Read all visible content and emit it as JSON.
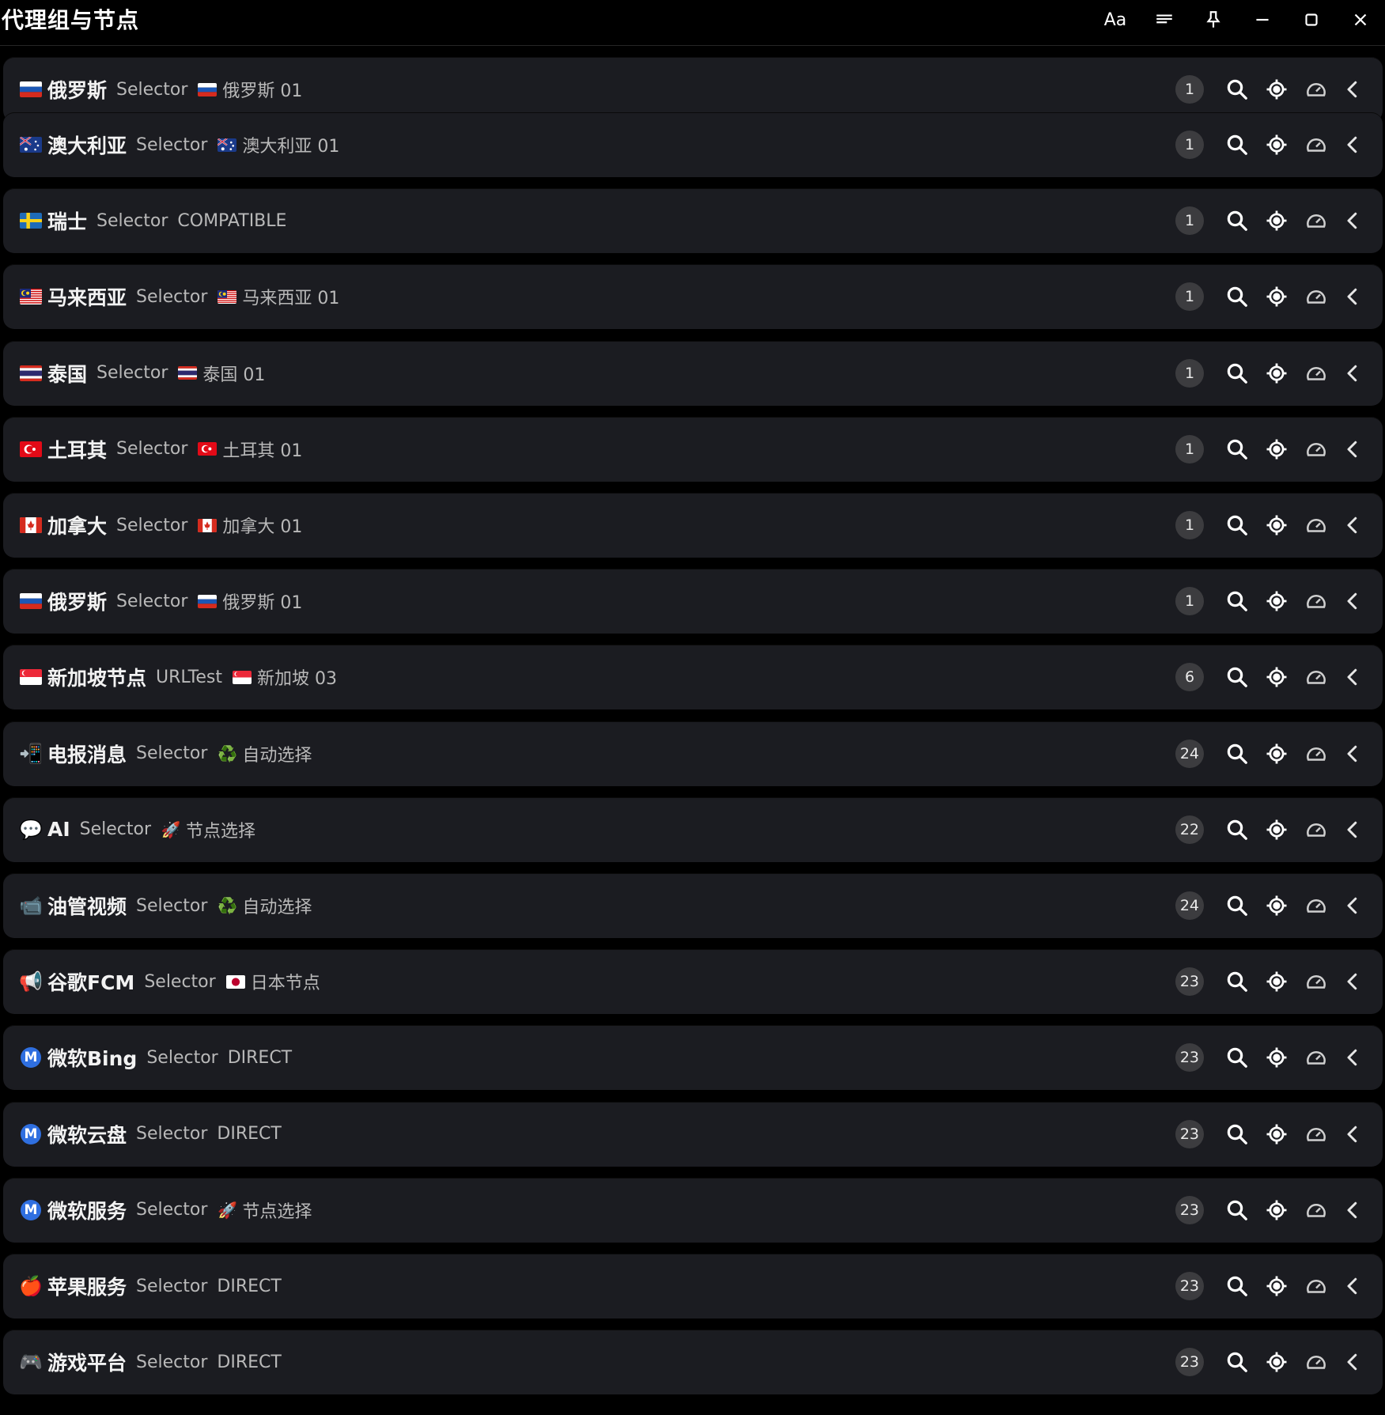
{
  "window": {
    "title": "代理组与节点",
    "font_button": "Aa",
    "icons": [
      "font-icon",
      "filter-lines-icon",
      "pin-icon",
      "minimize-icon",
      "maximize-icon",
      "close-icon"
    ]
  },
  "colors": {
    "background": "#000000",
    "card": "#1b1c21",
    "badge": "#3c3c3f",
    "text": "#f2f2f2",
    "subtext": "#b9b9b9"
  },
  "groups": [
    {
      "icon": "flag-ru",
      "name": "俄罗斯",
      "type": "Selector",
      "now_icon": "flag-ru",
      "now": "俄罗斯 01",
      "count": "1"
    },
    {
      "icon": "flag-au",
      "name": "澳大利亚",
      "type": "Selector",
      "now_icon": "flag-au",
      "now": "澳大利亚 01",
      "count": "1"
    },
    {
      "icon": "flag-se",
      "name": "瑞士",
      "type": "Selector",
      "now_icon": "",
      "now": "COMPATIBLE",
      "count": "1"
    },
    {
      "icon": "flag-my",
      "name": "马来西亚",
      "type": "Selector",
      "now_icon": "flag-my",
      "now": "马来西亚 01",
      "count": "1"
    },
    {
      "icon": "flag-th",
      "name": "泰国",
      "type": "Selector",
      "now_icon": "flag-th",
      "now": "泰国 01",
      "count": "1"
    },
    {
      "icon": "flag-tr",
      "name": "土耳其",
      "type": "Selector",
      "now_icon": "flag-tr",
      "now": "土耳其 01",
      "count": "1"
    },
    {
      "icon": "flag-ca",
      "name": "加拿大",
      "type": "Selector",
      "now_icon": "flag-ca",
      "now": "加拿大 01",
      "count": "1"
    },
    {
      "icon": "flag-ru",
      "name": "俄罗斯",
      "type": "Selector",
      "now_icon": "flag-ru",
      "now": "俄罗斯 01",
      "count": "1"
    },
    {
      "icon": "flag-sg",
      "name": "新加坡节点",
      "type": "URLTest",
      "now_icon": "flag-sg",
      "now": "新加坡 03",
      "count": "6"
    },
    {
      "icon": "phone-arrow-emoji",
      "name": "电报消息",
      "type": "Selector",
      "now_icon": "recycle-emoji",
      "now": "自动选择",
      "count": "24"
    },
    {
      "icon": "speech-bubble-emoji",
      "name": "AI",
      "type": "Selector",
      "now_icon": "rocket-emoji",
      "now": "节点选择",
      "count": "22"
    },
    {
      "icon": "video-camera-emoji",
      "name": "油管视频",
      "type": "Selector",
      "now_icon": "recycle-emoji",
      "now": "自动选择",
      "count": "24"
    },
    {
      "icon": "loudspeaker-emoji",
      "name": "谷歌FCM",
      "type": "Selector",
      "now_icon": "flag-jp",
      "now": "日本节点",
      "count": "23"
    },
    {
      "icon": "m-circle",
      "name": "微软Bing",
      "type": "Selector",
      "now_icon": "",
      "now": "DIRECT",
      "count": "23"
    },
    {
      "icon": "m-circle",
      "name": "微软云盘",
      "type": "Selector",
      "now_icon": "",
      "now": "DIRECT",
      "count": "23"
    },
    {
      "icon": "m-circle",
      "name": "微软服务",
      "type": "Selector",
      "now_icon": "rocket-emoji",
      "now": "节点选择",
      "count": "23"
    },
    {
      "icon": "apple-emoji",
      "name": "苹果服务",
      "type": "Selector",
      "now_icon": "",
      "now": "DIRECT",
      "count": "23"
    },
    {
      "icon": "gamepad-emoji",
      "name": "游戏平台",
      "type": "Selector",
      "now_icon": "",
      "now": "DIRECT",
      "count": "23"
    }
  ]
}
